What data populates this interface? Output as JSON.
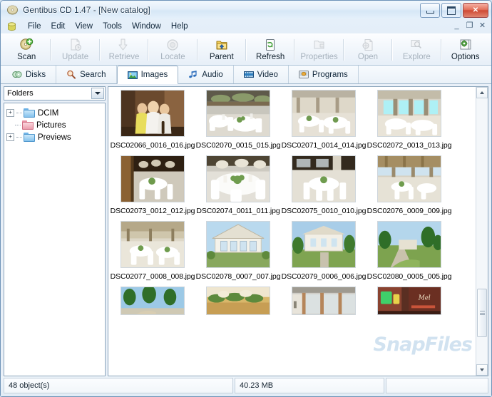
{
  "window": {
    "title": "Gentibus CD 1.47 - [New catalog]",
    "app_icon": "cd-disc-icon",
    "controls": {
      "minimize": "minimize-icon",
      "maximize": "maximize-icon",
      "close": "✕"
    },
    "mdi_controls": {
      "minimize": "_",
      "restore": "❐",
      "close": "✕"
    }
  },
  "menu": {
    "icon": "catalog-icon",
    "items": [
      {
        "label": "File"
      },
      {
        "label": "Edit"
      },
      {
        "label": "View"
      },
      {
        "label": "Tools"
      },
      {
        "label": "Window"
      },
      {
        "label": "Help"
      }
    ]
  },
  "toolbar": {
    "buttons": [
      {
        "label": "Scan",
        "icon": "scan-disc-icon",
        "enabled": true
      },
      {
        "label": "Update",
        "icon": "update-icon",
        "enabled": false
      },
      {
        "label": "Retrieve",
        "icon": "retrieve-icon",
        "enabled": false
      },
      {
        "label": "Locate",
        "icon": "locate-icon",
        "enabled": false
      },
      {
        "label": "Parent",
        "icon": "parent-folder-icon",
        "enabled": true
      },
      {
        "label": "Refresh",
        "icon": "refresh-icon",
        "enabled": true
      },
      {
        "label": "Properties",
        "icon": "properties-icon",
        "enabled": false
      },
      {
        "label": "Open",
        "icon": "open-icon",
        "enabled": false
      },
      {
        "label": "Explore",
        "icon": "explore-icon",
        "enabled": false
      },
      {
        "label": "Options",
        "icon": "options-gear-icon",
        "enabled": true
      }
    ]
  },
  "tabs": {
    "active": "Images",
    "items": [
      {
        "label": "Disks",
        "icon": "disks-icon"
      },
      {
        "label": "Search",
        "icon": "search-icon"
      },
      {
        "label": "Images",
        "icon": "images-icon"
      },
      {
        "label": "Audio",
        "icon": "audio-note-icon"
      },
      {
        "label": "Video",
        "icon": "video-film-icon"
      },
      {
        "label": "Programs",
        "icon": "programs-icon"
      }
    ]
  },
  "sidebar": {
    "combo": {
      "value": "Folders",
      "options": [
        "Folders"
      ]
    },
    "tree": [
      {
        "label": "DCIM",
        "expander": "+",
        "folder_color": "blue"
      },
      {
        "label": "Pictures",
        "expander": "",
        "folder_color": "red"
      },
      {
        "label": "Previews",
        "expander": "+",
        "folder_color": "blue"
      }
    ]
  },
  "thumbnails": {
    "rows": [
      [
        {
          "name": "DSC02066_0016_016.jpg",
          "scene": "people-portrait"
        },
        {
          "name": "DSC02070_0015_015.jpg",
          "scene": "banquet-tables"
        },
        {
          "name": "DSC02071_0014_014.jpg",
          "scene": "banquet-hall-wide"
        },
        {
          "name": "DSC02072_0013_013.jpg",
          "scene": "banquet-hall-windows"
        }
      ],
      [
        {
          "name": "DSC02073_0012_012.jpg",
          "scene": "banquet-doorway"
        },
        {
          "name": "DSC02074_0011_011.jpg",
          "scene": "set-table-closeup"
        },
        {
          "name": "DSC02075_0010_010.jpg",
          "scene": "round-table-chairs"
        },
        {
          "name": "DSC02076_0009_009.jpg",
          "scene": "hall-columns"
        }
      ],
      [
        {
          "name": "DSC02077_0008_008.jpg",
          "scene": "patio-tables"
        },
        {
          "name": "DSC02078_0007_007.jpg",
          "scene": "white-building"
        },
        {
          "name": "DSC02079_0006_006.jpg",
          "scene": "garden-pavilion"
        },
        {
          "name": "DSC02080_0005_005.jpg",
          "scene": "palm-walkway"
        }
      ],
      [
        {
          "name": "",
          "scene": "palms-sky"
        },
        {
          "name": "",
          "scene": "garland-planter"
        },
        {
          "name": "",
          "scene": "storefront"
        },
        {
          "name": "",
          "scene": "neon-bar"
        }
      ]
    ]
  },
  "scrollbar": {
    "up_arrow": "scroll-up-icon",
    "down_arrow": "scroll-down-icon",
    "thumb_position_pct": 72
  },
  "statusbar": {
    "object_count": "48 object(s)",
    "total_size": "40.23 MB",
    "extra": ""
  },
  "watermark": {
    "text": "SnapFiles"
  }
}
